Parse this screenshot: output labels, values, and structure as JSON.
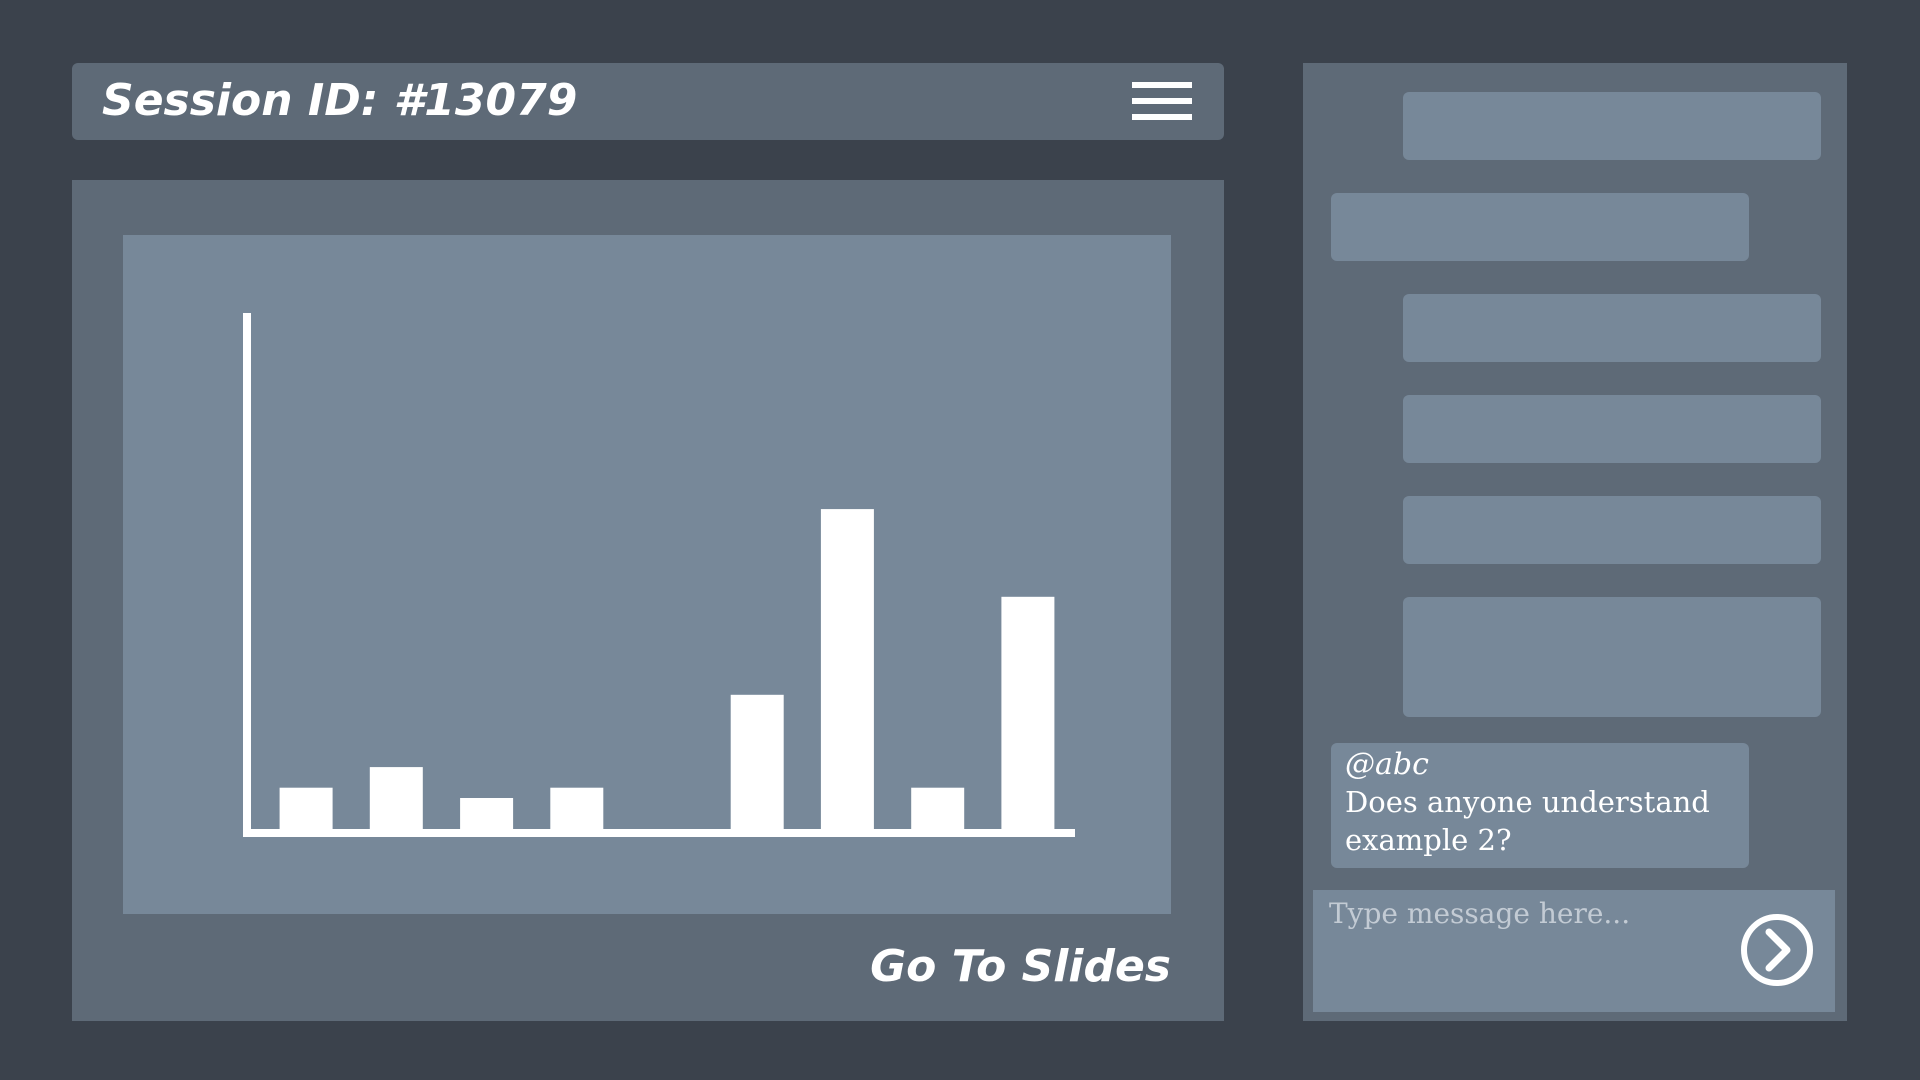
{
  "header": {
    "session_title": "Session ID: #13079",
    "menu_icon": "hamburger-menu-icon"
  },
  "main": {
    "go_to_slides_label": "Go To Slides"
  },
  "chart_data": {
    "type": "bar",
    "categories": [
      "",
      "",
      "",
      "",
      "",
      "",
      "",
      "",
      ""
    ],
    "values": [
      8,
      12,
      6,
      8,
      0,
      26,
      62,
      8,
      45
    ],
    "ylim": [
      0,
      100
    ],
    "grid": false,
    "xlabel": "",
    "ylabel": ""
  },
  "chat": {
    "message": {
      "user": "@abc",
      "text": "Does anyone understand example 2?"
    },
    "input": {
      "value": "",
      "placeholder": "Type message here..."
    },
    "send_icon": "chevron-right-circle-icon"
  },
  "colors": {
    "background": "#3b424c",
    "panel": "#5e6a77",
    "surface": "#778899",
    "foreground": "#ffffff"
  }
}
